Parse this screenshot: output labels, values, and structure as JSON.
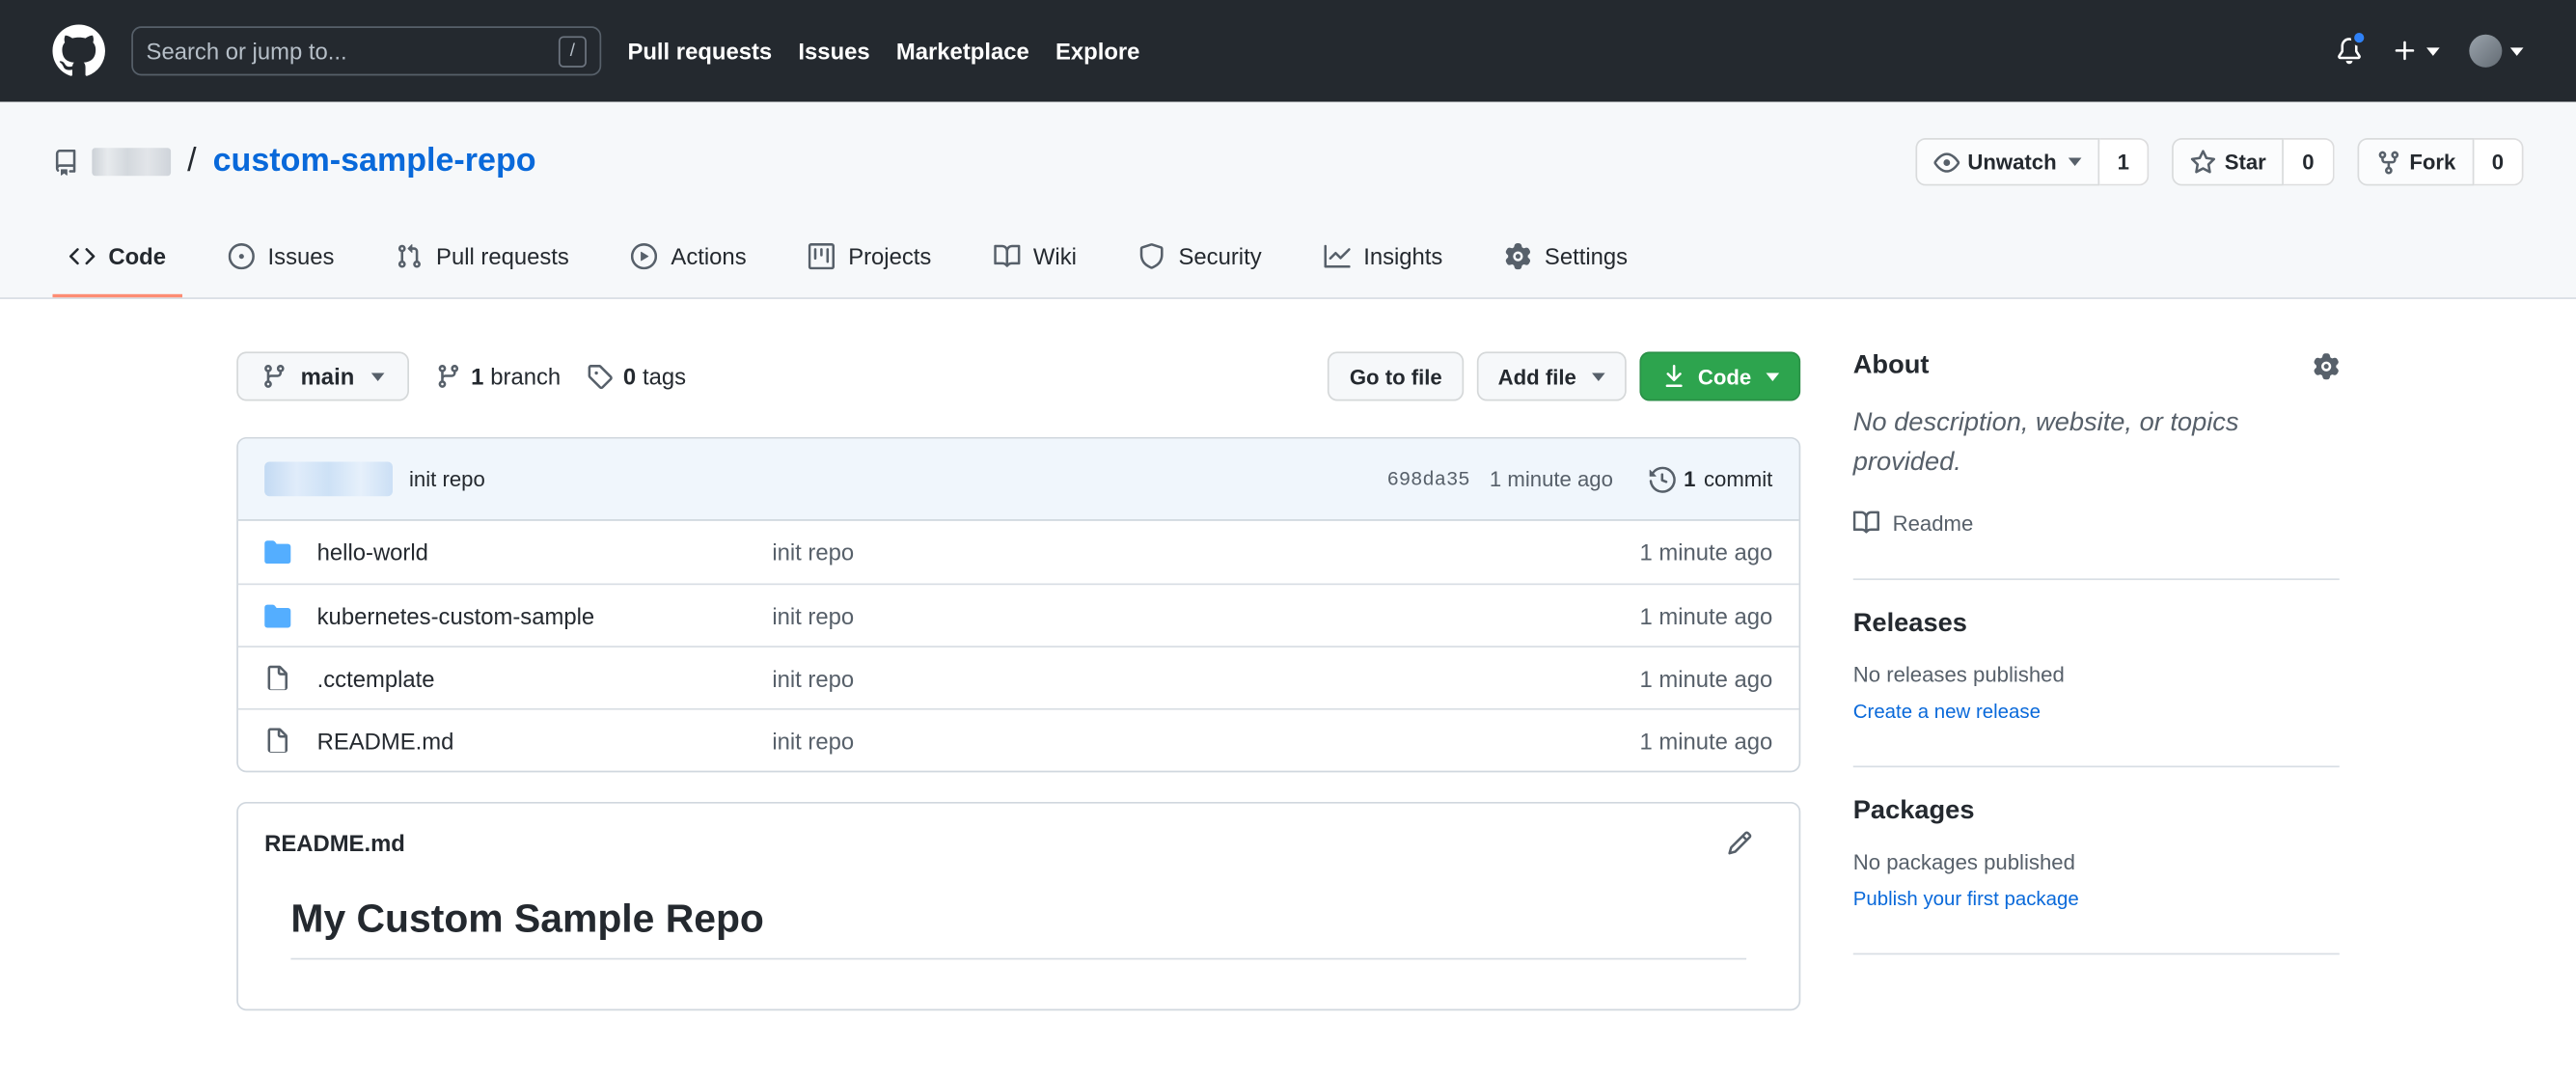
{
  "colors": {
    "header_bg": "#24292f",
    "link_blue": "#0969da",
    "primary_green": "#2da44e",
    "tab_accent": "#fd8c73",
    "muted_text": "#57606a",
    "border": "#d0d7de",
    "canvas_subtle": "#f6f8fa",
    "commit_bar_bg": "#f0f6fc",
    "folder_icon": "#54aeff",
    "notification_dot": "#2f81f7"
  },
  "header": {
    "search_placeholder": "Search or jump to...",
    "search_shortcut": "/",
    "nav": [
      {
        "label": "Pull requests"
      },
      {
        "label": "Issues"
      },
      {
        "label": "Marketplace"
      },
      {
        "label": "Explore"
      }
    ]
  },
  "repo_header": {
    "breadcrumb_separator": "/",
    "repo_name": "custom-sample-repo",
    "watch": {
      "label": "Unwatch",
      "count": "1"
    },
    "star": {
      "label": "Star",
      "count": "0"
    },
    "fork": {
      "label": "Fork",
      "count": "0"
    }
  },
  "tabs": [
    {
      "label": "Code",
      "icon": "code-icon",
      "active": true
    },
    {
      "label": "Issues",
      "icon": "issue-opened-icon",
      "active": false
    },
    {
      "label": "Pull requests",
      "icon": "git-pull-request-icon",
      "active": false
    },
    {
      "label": "Actions",
      "icon": "play-icon",
      "active": false
    },
    {
      "label": "Projects",
      "icon": "project-icon",
      "active": false
    },
    {
      "label": "Wiki",
      "icon": "book-icon",
      "active": false
    },
    {
      "label": "Security",
      "icon": "shield-icon",
      "active": false
    },
    {
      "label": "Insights",
      "icon": "graph-icon",
      "active": false
    },
    {
      "label": "Settings",
      "icon": "gear-icon",
      "active": false
    }
  ],
  "toolbar": {
    "branch_button_label": "main",
    "branches_count": "1",
    "branches_label": "branch",
    "tags_count": "0",
    "tags_label": "tags",
    "go_to_file_label": "Go to file",
    "add_file_label": "Add file",
    "code_button_label": "Code"
  },
  "commit_bar": {
    "message": "init repo",
    "sha": "698da35",
    "time": "1 minute ago",
    "commits_count": "1",
    "commits_label": "commit"
  },
  "files": [
    {
      "name": "hello-world",
      "type": "directory",
      "icon": "file-directory-icon",
      "commit_message": "init repo",
      "updated": "1 minute ago"
    },
    {
      "name": "kubernetes-custom-sample",
      "type": "directory",
      "icon": "file-directory-icon",
      "commit_message": "init repo",
      "updated": "1 minute ago"
    },
    {
      "name": ".cctemplate",
      "type": "file",
      "icon": "file-icon",
      "commit_message": "init repo",
      "updated": "1 minute ago"
    },
    {
      "name": "README.md",
      "type": "file",
      "icon": "file-icon",
      "commit_message": "init repo",
      "updated": "1 minute ago"
    }
  ],
  "readme": {
    "title": "README.md",
    "heading": "My Custom Sample Repo"
  },
  "sidebar": {
    "about": {
      "title": "About",
      "description": "No description, website, or topics provided.",
      "readme_label": "Readme"
    },
    "releases": {
      "title": "Releases",
      "empty_text": "No releases published",
      "cta": "Create a new release"
    },
    "packages": {
      "title": "Packages",
      "empty_text": "No packages published",
      "cta": "Publish your first package"
    }
  }
}
